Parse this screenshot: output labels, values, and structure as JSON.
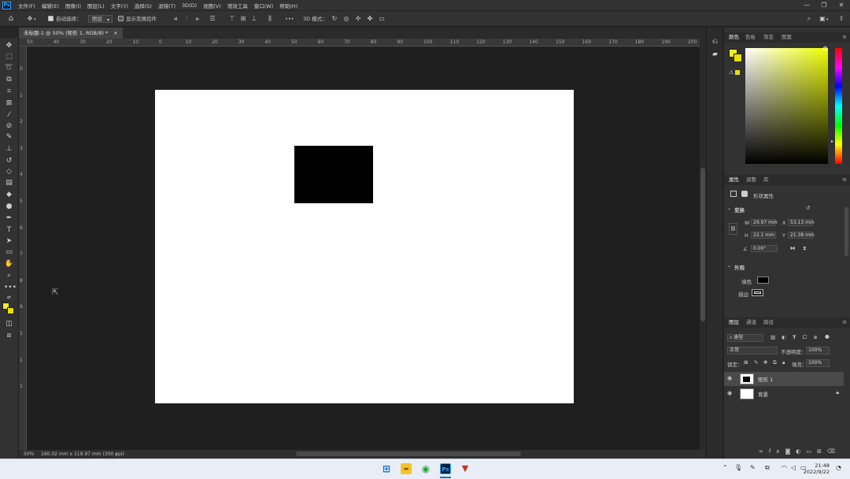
{
  "app": {
    "logo": "Ps",
    "menus": [
      "文件(F)",
      "编辑(E)",
      "图像(I)",
      "图层(L)",
      "文字(Y)",
      "选择(S)",
      "滤镜(T)",
      "3D(D)",
      "视图(V)",
      "增效工具",
      "窗口(W)",
      "帮助(H)"
    ],
    "window_controls": [
      "—",
      "❐",
      "✕"
    ]
  },
  "options": {
    "auto_select_label": "自动选择：",
    "auto_select_target": "图层",
    "show_transform_label": "显示变换控件",
    "more": "•••",
    "mode_3d_label": "3D 模式："
  },
  "document": {
    "tab_title": "未标题-1 @ 50% (矩形 1, RGB/8) *",
    "tab_close": "×"
  },
  "rulers": {
    "top": [
      "50",
      "40",
      "30",
      "20",
      "10",
      "0",
      "10",
      "20",
      "30",
      "40",
      "50",
      "60",
      "70",
      "80",
      "90",
      "100",
      "110",
      "120",
      "130",
      "140",
      "150",
      "160",
      "170",
      "180",
      "190",
      "200"
    ],
    "left": [
      "0",
      "1",
      "2",
      "3",
      "4",
      "5",
      "6",
      "7",
      "8",
      "9",
      "1",
      "1",
      "1"
    ]
  },
  "status": {
    "zoom": "50%",
    "doc_info": "160.02 mm x 119.97 mm (300 ppi)",
    "arrow": "›"
  },
  "color_panel": {
    "tabs": [
      "颜色",
      "色板",
      "渐变",
      "图案"
    ],
    "foreground": "#f0ee22",
    "background": "#e8e200"
  },
  "properties_panel": {
    "tabs": [
      "属性",
      "调整",
      "库"
    ],
    "header": "形状属性",
    "transform_section": "变换",
    "w_label": "W",
    "w_value": "29.97 mm",
    "x_label": "X",
    "x_value": "53.13 mm",
    "h_label": "H",
    "h_value": "22.1 mm",
    "y_label": "Y",
    "y_value": "21.38 mm",
    "angle_value": "0.00°",
    "appearance_section": "外观",
    "fill_label": "填色",
    "stroke_label": "描边",
    "fill_color": "#000000"
  },
  "layers_panel": {
    "tabs": [
      "图层",
      "通道",
      "路径"
    ],
    "filter_label": "类型",
    "blend_mode": "正常",
    "opacity_label": "不透明度：",
    "opacity_value": "100%",
    "lock_label": "锁定：",
    "fill_label": "填充：",
    "fill_value": "100%",
    "layers": [
      {
        "name": "矩形 1",
        "selected": true
      },
      {
        "name": "背景",
        "selected": false,
        "locked": true
      }
    ]
  },
  "taskbar": {
    "ps_label": "Ps",
    "time": "21:48",
    "date": "2022/9/22"
  }
}
